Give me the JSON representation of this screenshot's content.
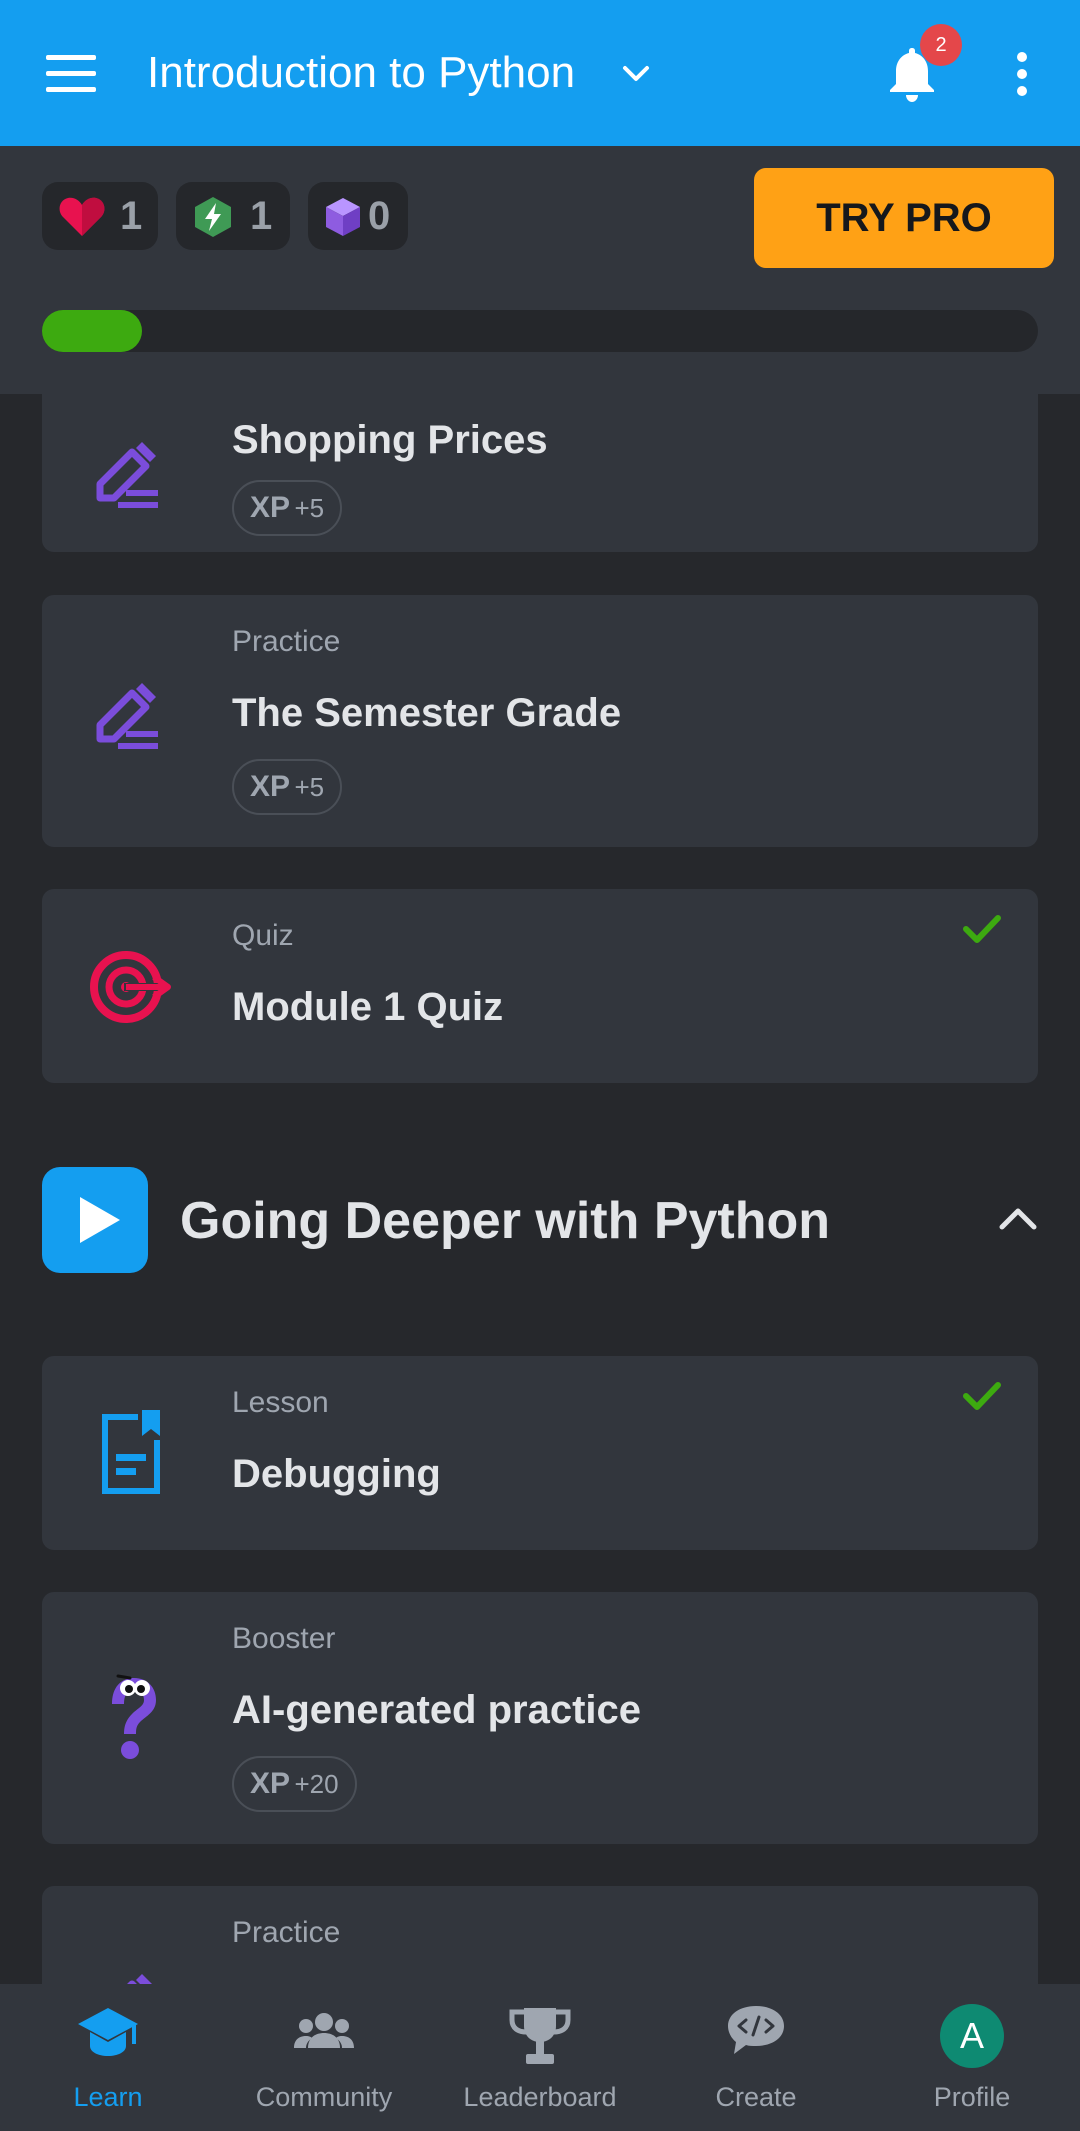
{
  "header": {
    "course_title": "Introduction to Python",
    "notification_count": "2"
  },
  "stats": {
    "hearts": "1",
    "streak": "1",
    "gems": "0",
    "try_pro_label": "TRY PRO",
    "progress_fraction": 0.1
  },
  "lessons": [
    {
      "kind": "",
      "title": "Shopping Prices",
      "xp_label": "XP",
      "xp_value": "+5",
      "icon": "pencil-icon",
      "completed": false
    },
    {
      "kind": "Practice",
      "title": "The Semester Grade",
      "xp_label": "XP",
      "xp_value": "+5",
      "icon": "pencil-icon",
      "completed": false
    },
    {
      "kind": "Quiz",
      "title": "Module 1 Quiz",
      "icon": "target-icon",
      "completed": true
    }
  ],
  "module": {
    "title": "Going Deeper with Python",
    "icon": "play-icon"
  },
  "module_items": [
    {
      "kind": "Lesson",
      "title": "Debugging",
      "icon": "lesson-document-icon",
      "completed": true
    },
    {
      "kind": "Booster",
      "title": "AI-generated practice",
      "xp_label": "XP",
      "xp_value": "+20",
      "icon": "question-mascot-icon",
      "completed": false
    },
    {
      "kind": "Practice",
      "title": "",
      "icon": "pencil-icon",
      "completed": false
    }
  ],
  "bottom_nav": [
    {
      "label": "Learn",
      "icon": "graduation-cap-icon",
      "active": true
    },
    {
      "label": "Community",
      "icon": "people-icon",
      "active": false
    },
    {
      "label": "Leaderboard",
      "icon": "trophy-icon",
      "active": false
    },
    {
      "label": "Create",
      "icon": "code-bubble-icon",
      "active": false
    },
    {
      "label": "Profile",
      "icon": "avatar-icon",
      "avatar_letter": "A",
      "active": false
    }
  ],
  "colors": {
    "accent": "#149ef0",
    "pro": "#ffa115",
    "progress": "#3daa10",
    "check": "#3daa10",
    "pencil": "#7b4ddb",
    "quiz": "#e8124f"
  }
}
